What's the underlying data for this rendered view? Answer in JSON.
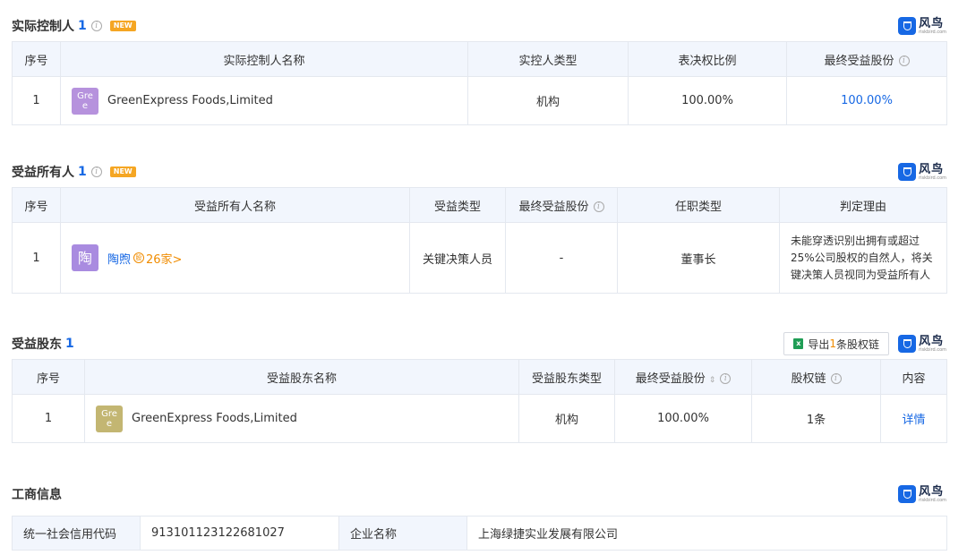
{
  "sections": {
    "actual_controller": {
      "title": "实际控制人",
      "count": "1",
      "badge": "NEW",
      "headers": [
        "序号",
        "实际控制人名称",
        "实控人类型",
        "表决权比例",
        "最终受益股份"
      ],
      "rows": [
        {
          "index": "1",
          "logo": "Gre e",
          "name": "GreenExpress Foods,Limited",
          "type": "机构",
          "voting": "100.00%",
          "benefit": "100.00%"
        }
      ]
    },
    "beneficial_owner": {
      "title": "受益所有人",
      "count": "1",
      "badge": "NEW",
      "headers": [
        "序号",
        "受益所有人名称",
        "受益类型",
        "最终受益股份",
        "任职类型",
        "判定理由"
      ],
      "rows": [
        {
          "index": "1",
          "logo": "陶",
          "name": "陶煦",
          "holdings": "26家>",
          "type": "关键决策人员",
          "benefit": "-",
          "position": "董事长",
          "reason": "未能穿透识别出拥有或超过25%公司股权的自然人，将关键决策人员视同为受益所有人"
        }
      ]
    },
    "beneficial_shareholder": {
      "title": "受益股东",
      "count": "1",
      "export": {
        "prefix": "导出",
        "num": "1",
        "suffix": "条股权链"
      },
      "headers": [
        "序号",
        "受益股东名称",
        "受益股东类型",
        "最终受益股份",
        "股权链",
        "内容"
      ],
      "rows": [
        {
          "index": "1",
          "logo": "Gre e",
          "name": "GreenExpress Foods,Limited",
          "type": "机构",
          "benefit": "100.00%",
          "chain": "1条",
          "detail": "详情"
        }
      ]
    },
    "business_info": {
      "title": "工商信息",
      "credit_code_label": "统一社会信用代码",
      "credit_code": "913101123122681027",
      "company_name_label": "企业名称",
      "company_name": "上海绿捷实业发展有限公司"
    }
  },
  "brand": {
    "name": "风鸟",
    "url": "riskbird.com",
    "color": "#1768e4"
  },
  "colors": {
    "accent": "#1768e4",
    "orange": "#f08c00",
    "header_bg": "#f2f6fd"
  }
}
